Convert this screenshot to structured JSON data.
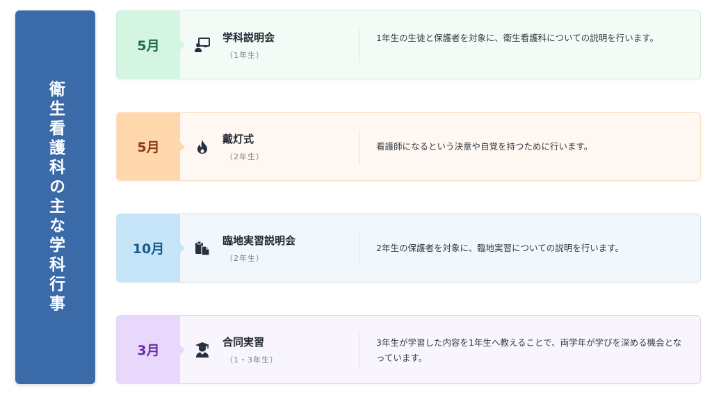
{
  "side_title": "衛生看護科の主な学科行事",
  "events": [
    {
      "month": "5月",
      "icon": "chalkboard-teacher-icon",
      "name": "学科説明会",
      "grade": "（1年生）",
      "description": "1年生の生徒と保護者を対象に、衛生看護科についての説明を行います。"
    },
    {
      "month": "5月",
      "icon": "flame-icon",
      "name": "戴灯式",
      "grade": "（2年生）",
      "description": "看護師になるという決意や自覚を持つために行います。"
    },
    {
      "month": "10月",
      "icon": "clipboard-copy-icon",
      "name": "臨地実習説明会",
      "grade": "（2年生）",
      "description": "2年生の保護者を対象に、臨地実習についての説明を行います。"
    },
    {
      "month": "3月",
      "icon": "graduate-user-icon",
      "name": "合同実習",
      "grade": "（1・3年生）",
      "description": "3年生が学習した内容を1年生へ教えることで、両学年が学びを深める機会となっています。"
    }
  ],
  "colors": {
    "title_bg": "#3a6ba8",
    "green_month": "#d4f5e2",
    "orange_month": "#fed7ac",
    "blue_month": "#c5e4f8",
    "purple_month": "#e8d8fb"
  }
}
